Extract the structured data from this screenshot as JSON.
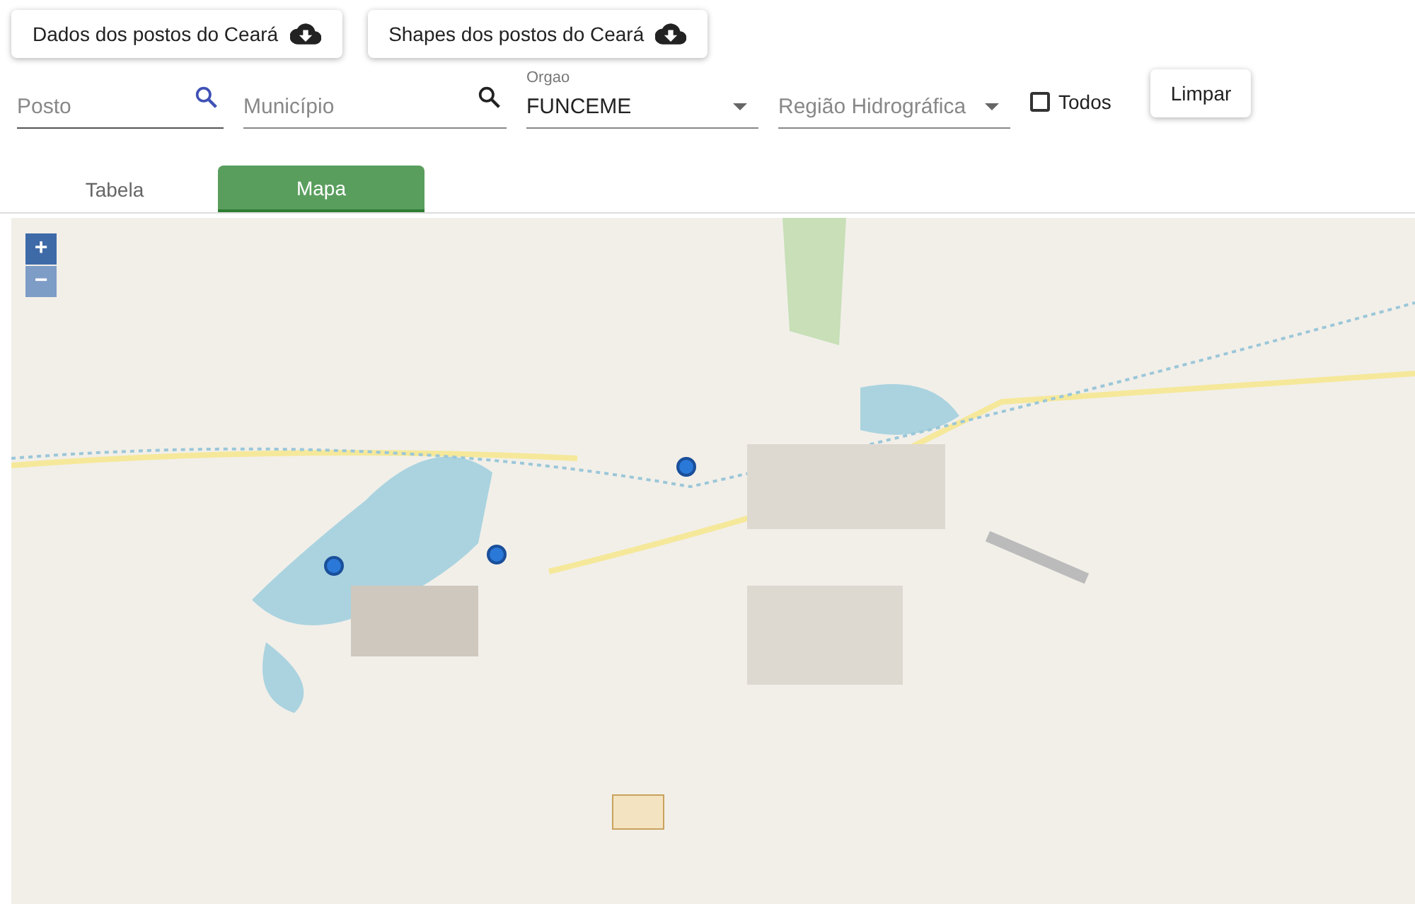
{
  "download_buttons": [
    {
      "label": "Dados dos postos do Ceará"
    },
    {
      "label": "Shapes dos postos do Ceará"
    }
  ],
  "filters": [
    {
      "kind": "search",
      "placeholder": "Posto",
      "focused": true
    },
    {
      "kind": "search",
      "placeholder": "Município",
      "focused": false
    },
    {
      "kind": "select",
      "label": "Orgao",
      "value": "FUNCEME"
    },
    {
      "kind": "select",
      "placeholder": "Região Hidrográfica"
    }
  ],
  "todos": {
    "label": "Todos",
    "checked": false
  },
  "clear_button": "Limpar",
  "tabs": [
    {
      "label": "Tabela",
      "selected": false
    },
    {
      "label": "Mapa",
      "selected": true
    }
  ],
  "map": {
    "zoom_controls": [
      {
        "label": "+",
        "disabled": false
      },
      {
        "label": "−",
        "disabled": true
      }
    ]
  }
}
